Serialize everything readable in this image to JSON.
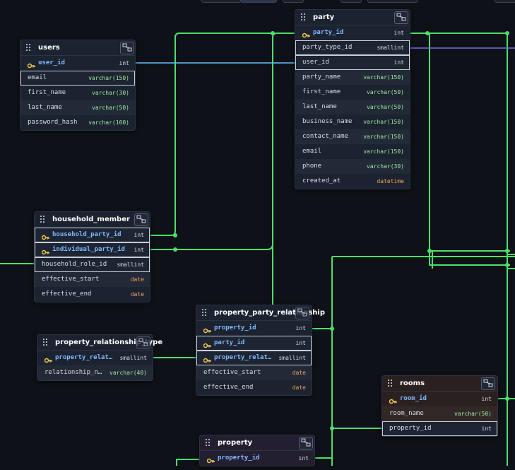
{
  "colors": {
    "background": "#0e1117",
    "relation_line": "#4ede6b",
    "relation_line_alt": "#66c2ff",
    "relation_line_purple": "#7f6ad8",
    "type_varchar": "#9fe6a0",
    "type_date": "#f0a35b",
    "primary_key": "#7fb8ff"
  },
  "tables": {
    "users": {
      "name": "users",
      "columns": [
        {
          "name": "user_id",
          "type": "int",
          "pk": true
        },
        {
          "name": "email",
          "type": "varchar(150)"
        },
        {
          "name": "first_name",
          "type": "varchar(30)"
        },
        {
          "name": "last_name",
          "type": "varchar(50)"
        },
        {
          "name": "password_hash",
          "type": "varchar(100)"
        }
      ]
    },
    "party": {
      "name": "party",
      "columns": [
        {
          "name": "party_id",
          "type": "int",
          "pk": true
        },
        {
          "name": "party_type_id",
          "type": "smallint"
        },
        {
          "name": "user_id",
          "type": "int"
        },
        {
          "name": "party_name",
          "type": "varchar(150)"
        },
        {
          "name": "first_name",
          "type": "varchar(50)"
        },
        {
          "name": "last_name",
          "type": "varchar(50)"
        },
        {
          "name": "business_name",
          "type": "varchar(150)"
        },
        {
          "name": "contact_name",
          "type": "varchar(150)"
        },
        {
          "name": "email",
          "type": "varchar(150)"
        },
        {
          "name": "phone",
          "type": "varchar(30)"
        },
        {
          "name": "created_at",
          "type": "datetime"
        }
      ]
    },
    "household_member": {
      "name": "household_member",
      "columns": [
        {
          "name": "household_party_id",
          "type": "int",
          "pk": true
        },
        {
          "name": "individual_party_id",
          "type": "int",
          "pk": true
        },
        {
          "name": "household_role_id",
          "type": "smallint"
        },
        {
          "name": "effective_start",
          "type": "date"
        },
        {
          "name": "effective_end",
          "type": "date"
        }
      ]
    },
    "property_party_relationship": {
      "name": "property_party_relationship",
      "columns": [
        {
          "name": "property_id",
          "type": "int",
          "pk": true
        },
        {
          "name": "party_id",
          "type": "int",
          "pk": true
        },
        {
          "name": "property_relat…",
          "type": "smallint",
          "pk": true
        },
        {
          "name": "effective_start",
          "type": "date"
        },
        {
          "name": "effective_end",
          "type": "date"
        }
      ]
    },
    "property_relationship_type": {
      "name": "property_relationship_type",
      "columns": [
        {
          "name": "property_relat…",
          "type": "smallint",
          "pk": true
        },
        {
          "name": "relationship_n…",
          "type": "varchar(40)"
        }
      ]
    },
    "rooms": {
      "name": "rooms",
      "columns": [
        {
          "name": "room_id",
          "type": "int",
          "pk": true
        },
        {
          "name": "room_name",
          "type": "varchar(50)"
        },
        {
          "name": "property_id",
          "type": "int"
        }
      ]
    },
    "property": {
      "name": "property",
      "columns": [
        {
          "name": "property_id",
          "type": "int",
          "pk": true
        }
      ]
    }
  }
}
